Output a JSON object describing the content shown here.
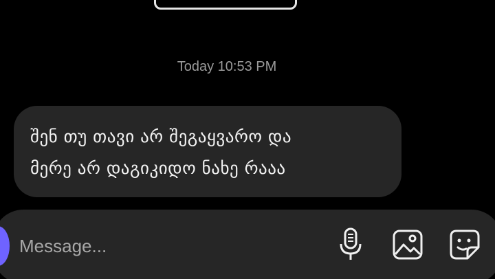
{
  "conversation": {
    "timestamp": "Today 10:53 PM",
    "messages": [
      {
        "text": "შენ თუ თავი არ შეგაყვარო და\nმერე არ დაგიკიდო ნახე რააა"
      }
    ]
  },
  "composer": {
    "placeholder": "Message..."
  },
  "icons": {
    "voice": "microphone-icon",
    "gallery": "image-icon",
    "sticker": "sticker-icon"
  },
  "colors": {
    "background": "#000000",
    "bubble": "#262626",
    "composer": "#262626",
    "accent": "#6f63ff",
    "timestamp": "#9a9a9a",
    "text": "#f2f2f2"
  }
}
